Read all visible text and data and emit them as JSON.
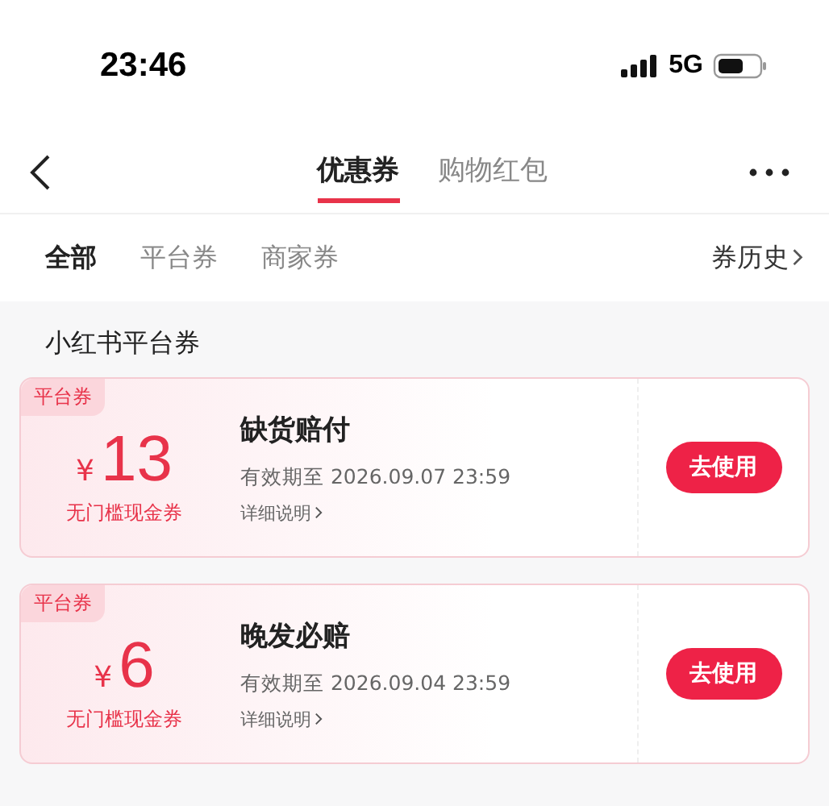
{
  "status_bar": {
    "time": "23:46",
    "network": "5G"
  },
  "tabs": [
    {
      "label": "优惠券",
      "selected": true
    },
    {
      "label": "购物红包",
      "selected": false
    }
  ],
  "filters": [
    {
      "label": "全部",
      "selected": true
    },
    {
      "label": "平台券",
      "selected": false
    },
    {
      "label": "商家券",
      "selected": false
    }
  ],
  "history_link": "券历史",
  "section_title": "小红书平台券",
  "coupons": [
    {
      "tag": "平台券",
      "currency": "¥",
      "amount": "13",
      "condition": "无门槛现金券",
      "title": "缺货赔付",
      "expiry": "有效期至 2026.09.07 23:59",
      "details": "详细说明",
      "action": "去使用"
    },
    {
      "tag": "平台券",
      "currency": "¥",
      "amount": "6",
      "condition": "无门槛现金券",
      "title": "晚发必赔",
      "expiry": "有效期至 2026.09.04 23:59",
      "details": "详细说明",
      "action": "去使用"
    }
  ]
}
